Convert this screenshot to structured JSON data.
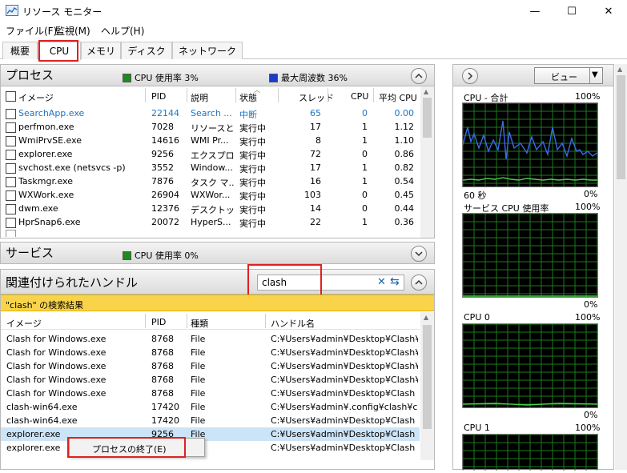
{
  "window": {
    "title": "リソース モニター",
    "minimize": "—",
    "maximize": "☐",
    "close": "✕"
  },
  "menu": [
    {
      "label": "ファイル(F)"
    },
    {
      "label": "監視(M)"
    },
    {
      "label": "ヘルプ(H)"
    }
  ],
  "tabs": [
    {
      "label": "概要"
    },
    {
      "label": "CPU"
    },
    {
      "label": "メモリ"
    },
    {
      "label": "ディスク"
    },
    {
      "label": "ネットワーク"
    }
  ],
  "processes": {
    "title": "プロセス",
    "cpu_usage": "CPU 使用率 3%",
    "max_freq": "最大周波数 36%",
    "columns": {
      "image": "イメージ",
      "pid": "PID",
      "desc": "説明",
      "status": "状態",
      "threads": "スレッド",
      "cpu": "CPU",
      "avg_cpu": "平均 CPU"
    },
    "rows": [
      {
        "image": "SearchApp.exe",
        "pid": "22144",
        "desc": "Search ...",
        "status": "中断",
        "threads": "65",
        "cpu": "0",
        "avg_cpu": "0.00"
      },
      {
        "image": "perfmon.exe",
        "pid": "7028",
        "desc": "リソースと...",
        "status": "実行中",
        "threads": "17",
        "cpu": "1",
        "avg_cpu": "1.12"
      },
      {
        "image": "WmiPrvSE.exe",
        "pid": "14616",
        "desc": "WMI Pr...",
        "status": "実行中",
        "threads": "8",
        "cpu": "1",
        "avg_cpu": "1.10"
      },
      {
        "image": "explorer.exe",
        "pid": "9256",
        "desc": "エクスプロ...",
        "status": "実行中",
        "threads": "72",
        "cpu": "0",
        "avg_cpu": "0.86"
      },
      {
        "image": "svchost.exe (netsvcs -p)",
        "pid": "3552",
        "desc": "Window...",
        "status": "実行中",
        "threads": "17",
        "cpu": "1",
        "avg_cpu": "0.82"
      },
      {
        "image": "Taskmgr.exe",
        "pid": "7876",
        "desc": "タスク マ...",
        "status": "実行中",
        "threads": "16",
        "cpu": "1",
        "avg_cpu": "0.54"
      },
      {
        "image": "WXWork.exe",
        "pid": "26904",
        "desc": "WXWor...",
        "status": "実行中",
        "threads": "103",
        "cpu": "0",
        "avg_cpu": "0.45"
      },
      {
        "image": "dwm.exe",
        "pid": "12376",
        "desc": "デスクトッ...",
        "status": "実行中",
        "threads": "14",
        "cpu": "0",
        "avg_cpu": "0.44"
      },
      {
        "image": "HprSnap6.exe",
        "pid": "20072",
        "desc": "HyperS...",
        "status": "実行中",
        "threads": "22",
        "cpu": "1",
        "avg_cpu": "0.36"
      }
    ]
  },
  "services": {
    "title": "サービス",
    "cpu_usage": "CPU 使用率 0%"
  },
  "handles": {
    "title": "関連付けられたハンドル",
    "search_value": "clash",
    "result_banner": "\"clash\" の検索結果",
    "columns": {
      "image": "イメージ",
      "pid": "PID",
      "type": "種類",
      "handle": "ハンドル名"
    },
    "rows": [
      {
        "image": "Clash for Windows.exe",
        "pid": "8768",
        "type": "File",
        "handle": "C:¥Users¥admin¥Desktop¥Clash¥r..."
      },
      {
        "image": "Clash for Windows.exe",
        "pid": "8768",
        "type": "File",
        "handle": "C:¥Users¥admin¥Desktop¥Clash¥r..."
      },
      {
        "image": "Clash for Windows.exe",
        "pid": "8768",
        "type": "File",
        "handle": "C:¥Users¥admin¥Desktop¥Clash¥v..."
      },
      {
        "image": "Clash for Windows.exe",
        "pid": "8768",
        "type": "File",
        "handle": "C:¥Users¥admin¥Desktop¥Clash¥ic..."
      },
      {
        "image": "Clash for Windows.exe",
        "pid": "8768",
        "type": "File",
        "handle": "C:¥Users¥admin¥Desktop¥Clash"
      },
      {
        "image": "clash-win64.exe",
        "pid": "17420",
        "type": "File",
        "handle": "C:¥Users¥admin¥.config¥clash¥cac..."
      },
      {
        "image": "clash-win64.exe",
        "pid": "17420",
        "type": "File",
        "handle": "C:¥Users¥admin¥Desktop¥Clash"
      },
      {
        "image": "explorer.exe",
        "pid": "9256",
        "type": "File",
        "handle": "C:¥Users¥admin¥Desktop¥Clash"
      },
      {
        "image": "explorer.exe",
        "pid": "9256",
        "type": "File",
        "handle": "C:¥Users¥admin¥Desktop¥Clash"
      }
    ],
    "context_menu": "プロセスの終了(E)"
  },
  "right_panel": {
    "view_button": "ビュー",
    "graphs": [
      {
        "title": "CPU - 合計",
        "top_value": "100%",
        "bottom_left": "60 秒",
        "bottom_right": "0%"
      },
      {
        "title": "サービス CPU 使用率",
        "top_value": "100%",
        "bottom_left": "",
        "bottom_right": "0%"
      },
      {
        "title": "CPU 0",
        "top_value": "100%",
        "bottom_left": "",
        "bottom_right": "0%"
      },
      {
        "title": "CPU 1",
        "top_value": "100%",
        "bottom_left": "",
        "bottom_right": ""
      }
    ]
  },
  "colors": {
    "cpu_green": "#1e8a1e",
    "freq_blue": "#1a3cc8",
    "highlight_red": "#e02020",
    "search_banner": "#f9d44a",
    "selected_row": "#cce4f7",
    "suspended_text": "#1c73c6"
  }
}
